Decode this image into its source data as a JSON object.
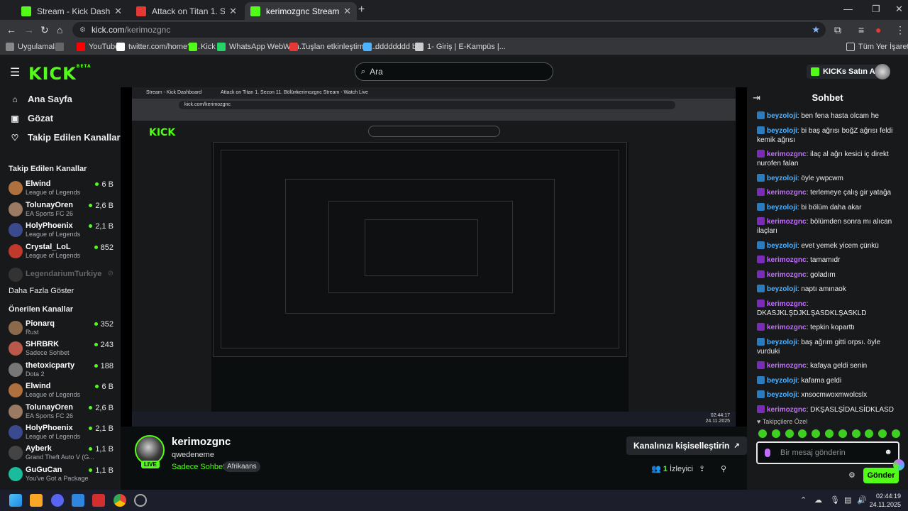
{
  "browser": {
    "tabs": [
      {
        "title": "Stream - Kick Dashboard",
        "active": false,
        "icon_color": "#53fc18"
      },
      {
        "title": "Attack on Titan 1. Sezon 11. Bölüm",
        "active": false,
        "icon_color": "#e53935"
      },
      {
        "title": "kerimozgnc Stream - Watch Live",
        "active": true,
        "icon_color": "#53fc18"
      }
    ],
    "address": {
      "domain": "kick.com",
      "path": "/kerimozgnc"
    },
    "bookmarks": [
      {
        "label": "Uygulamalar",
        "color": "#888"
      },
      {
        "label": "YouTube",
        "color": "#ff0000"
      },
      {
        "label": "twitter.com/home?l...",
        "color": "#ffffff"
      },
      {
        "label": "Kick",
        "color": "#53fc18"
      },
      {
        "label": "WhatsApp WebWha...",
        "color": "#25d366"
      },
      {
        "label": "Tuşlan etkinleştirme...",
        "color": "#e53935"
      },
      {
        "label": "dddddddd b",
        "color": "#4fb2ff"
      },
      {
        "label": "1- Giriş | E-Kampüs |...",
        "color": "#ccc"
      }
    ],
    "all_bookmarks": "Tüm Yer İşaretleri"
  },
  "kick": {
    "search_placeholder": "Ara",
    "kicks_button": "KICKs Satın Al",
    "nav": [
      {
        "label": "Ana Sayfa",
        "icon": "home-icon",
        "glyph": "⌂"
      },
      {
        "label": "Gözat",
        "icon": "browse-icon",
        "glyph": "▣"
      },
      {
        "label": "Takip Edilen Kanallar",
        "icon": "heart-icon",
        "glyph": "♡"
      }
    ],
    "followed_title": "Takip Edilen Kanallar",
    "followed": [
      {
        "name": "Elwind",
        "game": "League of Legends",
        "viewers": "6 B",
        "color": "#b0703d"
      },
      {
        "name": "TolunayOren",
        "game": "EA Sports FC 26",
        "viewers": "2,6 B",
        "color": "#9a7a62"
      },
      {
        "name": "HolyPhoenix",
        "game": "League of Legends",
        "viewers": "2,1 B",
        "color": "#3b4a8f"
      },
      {
        "name": "Crystal_LoL",
        "game": "League of Legends",
        "viewers": "852",
        "color": "#c0392b"
      }
    ],
    "offline_channel": "LegendariumTurkiye",
    "show_more": "Daha Fazla Göster",
    "recommended_title": "Önerilen Kanallar",
    "recommended": [
      {
        "name": "Pionarq",
        "game": "Rust",
        "viewers": "352",
        "color": "#8a6a4a"
      },
      {
        "name": "SHRBRK",
        "game": "Sadece Sohbet",
        "viewers": "243",
        "color": "#b9594a"
      },
      {
        "name": "thetoxicparty",
        "game": "Dota 2",
        "viewers": "188",
        "color": "#777"
      },
      {
        "name": "Elwind",
        "game": "League of Legends",
        "viewers": "6 B",
        "color": "#b0703d"
      },
      {
        "name": "TolunayOren",
        "game": "EA Sports FC 26",
        "viewers": "2,6 B",
        "color": "#9a7a62"
      },
      {
        "name": "HolyPhoenix",
        "game": "League of Legends",
        "viewers": "2,1 B",
        "color": "#3b4a8f"
      },
      {
        "name": "Ayberk",
        "game": "Grand Theft Auto V (G...",
        "viewers": "1,1 B",
        "color": "#444"
      },
      {
        "name": "GuGuCan",
        "game": "You've Got a Package",
        "viewers": "1,1 B",
        "color": "#1abc9c"
      }
    ]
  },
  "stream": {
    "live_badge": "LIVE",
    "streamer": "kerimozgnc",
    "title": "qwedeneme",
    "category": "Sadece Sohbet",
    "tag": "Afrikaans",
    "customize_label": "Kanalınızı kişiselleştirin",
    "viewers_count": "1",
    "viewers_label": "İzleyici"
  },
  "chat": {
    "title": "Sohbet",
    "messages": [
      {
        "user": "beyzoloji",
        "type": "b",
        "text": "ben fena hasta olcam he"
      },
      {
        "user": "beyzoloji",
        "type": "b",
        "text": "bi baş ağrısı boğZ ağrısı feldi kemik ağrısı"
      },
      {
        "user": "kerimozgnc",
        "type": "k",
        "text": "ilaç al ağrı kesici iç direkt nurofen falan"
      },
      {
        "user": "beyzoloji",
        "type": "b",
        "text": "öyle ywpcwm"
      },
      {
        "user": "kerimozgnc",
        "type": "k",
        "text": "terlemeye çalış gir yatağa"
      },
      {
        "user": "beyzoloji",
        "type": "b",
        "text": "bi bölüm daha akar"
      },
      {
        "user": "kerimozgnc",
        "type": "k",
        "text": "bölümden sonra mı alıcan ilaçları"
      },
      {
        "user": "beyzoloji",
        "type": "b",
        "text": "evet yemek yicem çünkü"
      },
      {
        "user": "kerimozgnc",
        "type": "k",
        "text": "tamamıdr"
      },
      {
        "user": "kerimozgnc",
        "type": "k",
        "text": "goladım"
      },
      {
        "user": "beyzoloji",
        "type": "b",
        "text": "naptı amınaok"
      },
      {
        "user": "kerimozgnc",
        "type": "k",
        "text": "DKASJKLŞDJKLŞASDKLŞASKLD"
      },
      {
        "user": "kerimozgnc",
        "type": "k",
        "text": "tepkin koparttı"
      },
      {
        "user": "beyzoloji",
        "type": "b",
        "text": "baş ağrım gitti orpsı. öyle vurduki"
      },
      {
        "user": "kerimozgnc",
        "type": "k",
        "text": "kafaya geldi senin"
      },
      {
        "user": "beyzoloji",
        "type": "b",
        "text": "kafama geldi"
      },
      {
        "user": "beyzoloji",
        "type": "b",
        "text": "xnsocmwoxmwolcslx"
      },
      {
        "user": "kerimozgnc",
        "type": "k",
        "text": "DKŞASLŞİDALSİDKLASD"
      }
    ],
    "subscribers_label": "Takipçilere Özel",
    "input_placeholder": "Bir mesaj gönderin",
    "send_label": "Gönder"
  },
  "taskbar": {
    "time": "02:44:19",
    "date": "24.11.2025"
  },
  "inner_mirror": {
    "address": "kick.com/kerimozgnc",
    "time": "02:44:17",
    "date": "24.11.2025"
  }
}
